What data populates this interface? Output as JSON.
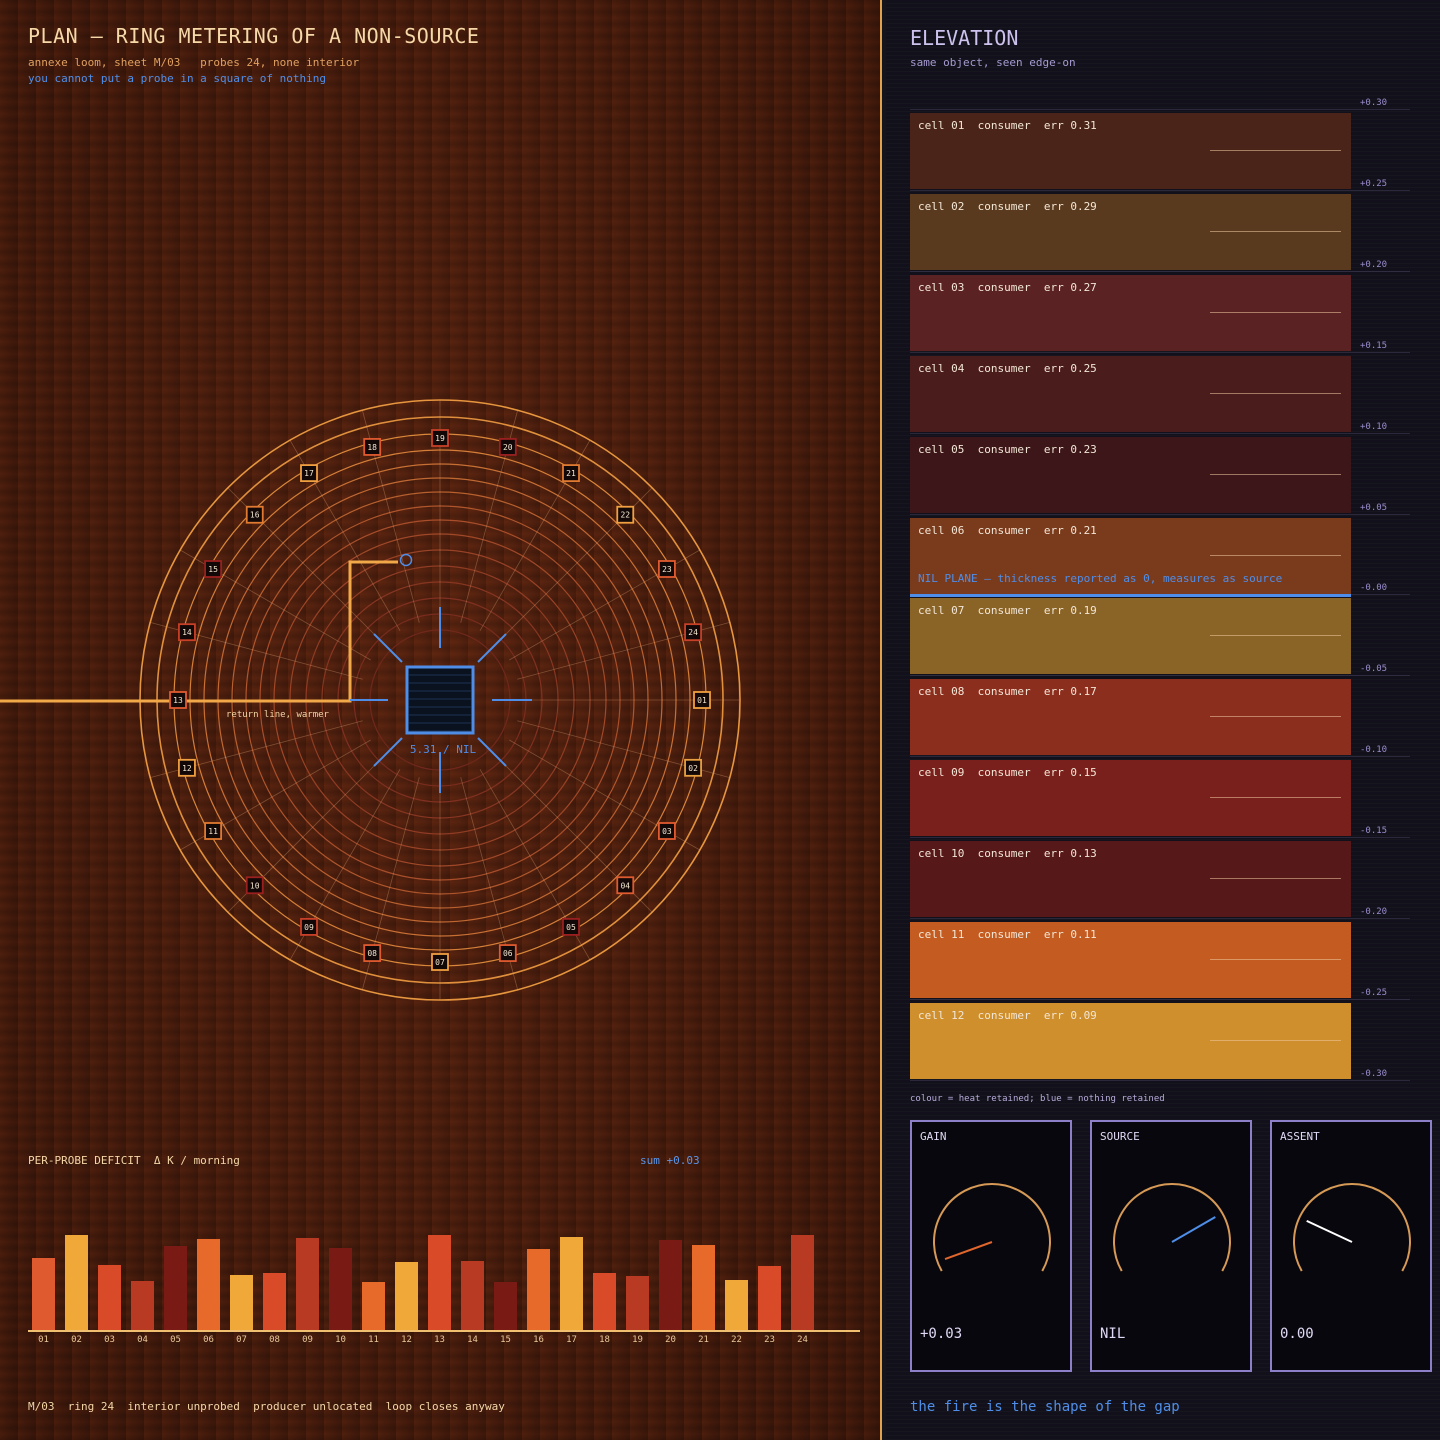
{
  "plan": {
    "title": "PLAN — RING METERING OF A NON-SOURCE",
    "subtitle": "annexe loom, sheet M/03   probes 24, none interior",
    "note": "you cannot put a probe in a square of nothing",
    "center_label": "5.31 / NIL",
    "return_label": "return line, warmer",
    "probes": [
      "01",
      "02",
      "03",
      "04",
      "05",
      "06",
      "07",
      "08",
      "09",
      "10",
      "11",
      "12",
      "13",
      "14",
      "15",
      "16",
      "17",
      "18",
      "19",
      "20",
      "21",
      "22",
      "23",
      "24"
    ],
    "probe_colors": [
      "#f0a040",
      "#e8a040",
      "#e05a30",
      "#e05a30",
      "#9a2020",
      "#e05a30",
      "#f0a040",
      "#e05a30",
      "#c84028",
      "#9a2020",
      "#e07a30",
      "#f0a040",
      "#e05a30",
      "#c84028",
      "#9a2020",
      "#e07a30",
      "#f0a040",
      "#e05a30",
      "#c84028",
      "#9a2020",
      "#e07a30",
      "#f0a040",
      "#e05a30",
      "#c84028"
    ]
  },
  "bars": {
    "title": "PER-PROBE DEFICIT  Δ K / morning",
    "sum": "sum +0.03",
    "footer": "M/03  ring 24  interior unprobed  producer unlocated  loop closes anyway"
  },
  "chart_data": {
    "type": "bar",
    "categories": [
      "01",
      "02",
      "03",
      "04",
      "05",
      "06",
      "07",
      "08",
      "09",
      "10",
      "11",
      "12",
      "13",
      "14",
      "15",
      "16",
      "17",
      "18",
      "19",
      "20",
      "21",
      "22",
      "23",
      "24"
    ],
    "values": [
      0.72,
      0.95,
      0.65,
      0.49,
      0.84,
      0.91,
      0.55,
      0.57,
      0.92,
      0.82,
      0.48,
      0.68,
      0.95,
      0.69,
      0.48,
      0.81,
      0.93,
      0.57,
      0.54,
      0.9,
      0.85,
      0.5,
      0.64,
      0.95
    ],
    "colors": [
      "#e05a30",
      "#f0a838",
      "#d94a28",
      "#b83a22",
      "#7a1a14",
      "#e86a2a",
      "#f0a838",
      "#d94a28",
      "#b83a22",
      "#7a1a14",
      "#e86a2a",
      "#f0a838",
      "#d94a28",
      "#b83a22",
      "#7a1a14",
      "#e86a2a",
      "#f0a838",
      "#d94a28",
      "#b83a22",
      "#7a1a14",
      "#e86a2a",
      "#f0a838",
      "#d94a28",
      "#b83a22"
    ],
    "title": "PER-PROBE DEFICIT  Δ K / morning"
  },
  "elevation": {
    "title": "ELEVATION",
    "subtitle": "same object, seen edge-on",
    "cells": [
      {
        "label": "cell 01  consumer  err 0.31",
        "color": "#4a2418"
      },
      {
        "label": "cell 02  consumer  err 0.29",
        "color": "#5a3a1e"
      },
      {
        "label": "cell 03  consumer  err 0.27",
        "color": "#5a2222"
      },
      {
        "label": "cell 04  consumer  err 0.25",
        "color": "#4a1c1c"
      },
      {
        "label": "cell 05  consumer  err 0.23",
        "color": "#3c1618"
      },
      {
        "label": "cell 06  consumer  err 0.21",
        "color": "#7a3a1c"
      },
      {
        "label": "cell 07  consumer  err 0.19",
        "color": "#8a6426"
      },
      {
        "label": "cell 08  consumer  err 0.17",
        "color": "#8c2e1e"
      },
      {
        "label": "cell 09  consumer  err 0.15",
        "color": "#7a201c"
      },
      {
        "label": "cell 10  consumer  err 0.13",
        "color": "#561818"
      },
      {
        "label": "cell 11  consumer  err 0.11",
        "color": "#c45c22"
      },
      {
        "label": "cell 12  consumer  err 0.09",
        "color": "#cf8f2c"
      }
    ],
    "ticks": [
      "+0.30",
      "+0.25",
      "+0.20",
      "+0.15",
      "+0.10",
      "+0.05",
      "-0.00",
      "-0.05",
      "-0.10",
      "-0.15",
      "-0.20",
      "-0.25",
      "-0.30"
    ],
    "nil_label": "NIL PLANE — thickness reported as 0, measures as source",
    "legend": "colour = heat retained; blue = nothing retained",
    "gauges": [
      {
        "label": "GAIN",
        "value": "+0.03",
        "needle_color": "#e0662e"
      },
      {
        "label": "SOURCE",
        "value": "NIL",
        "needle_color": "#4f8ee8"
      },
      {
        "label": "ASSENT",
        "value": "0.00",
        "needle_color": "#ffffff"
      }
    ],
    "footer": "the fire is the shape of the gap"
  }
}
